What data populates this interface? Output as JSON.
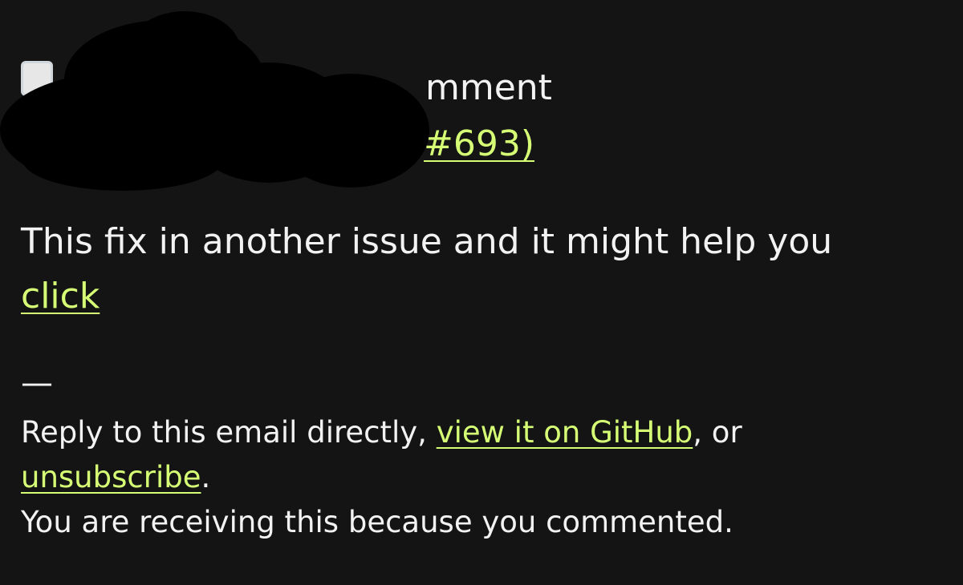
{
  "header": {
    "title_visible_fragment": "mment",
    "issue_link_visible_fragment": "#693)"
  },
  "comment": {
    "text": "This fix in another issue and it might help you",
    "link_label": "click"
  },
  "footer": {
    "separator": "—",
    "reply_prefix": "Reply to this email directly, ",
    "view_link": "view it on GitHub",
    "or_text": ", or",
    "unsubscribe_link": "unsubscribe",
    "period": ".",
    "reason": "You are receiving this because you commented."
  },
  "colors": {
    "background": "#141414",
    "text": "#f2f2f2",
    "link": "#d6ff75",
    "redaction": "#000000"
  },
  "icons": {
    "avatar": "user-avatar"
  }
}
